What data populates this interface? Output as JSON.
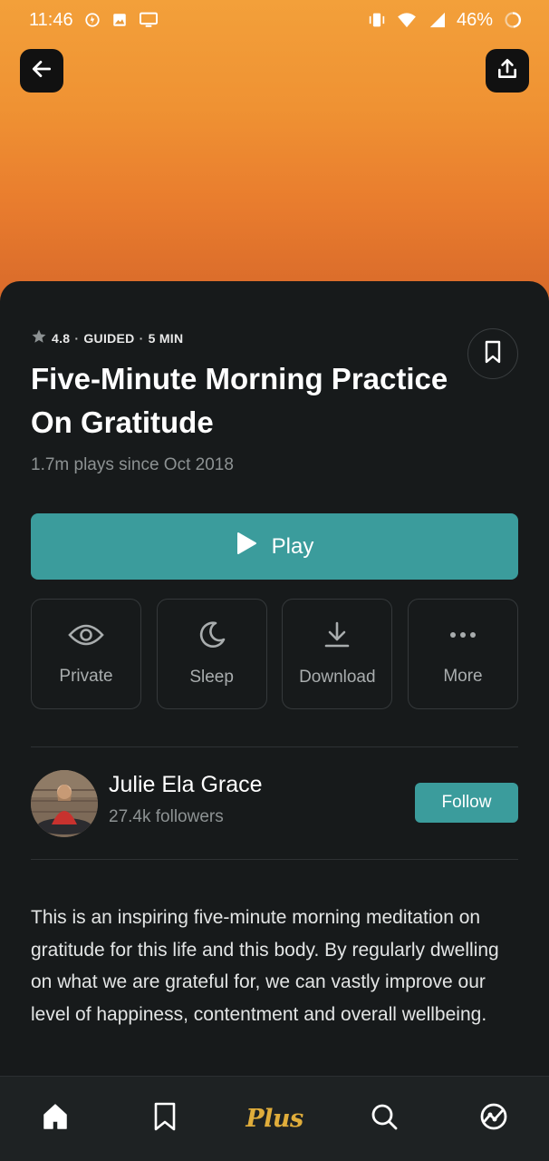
{
  "status_bar": {
    "time": "11:46",
    "battery": "46%",
    "icons_left": [
      "data-saver-icon",
      "image-icon",
      "cast-icon"
    ],
    "icons_right": [
      "vibrate-icon",
      "wifi-icon",
      "signal-icon",
      "battery-icon"
    ]
  },
  "hero": {
    "back_icon": "arrow-left-icon",
    "share_icon": "share-icon"
  },
  "meditation": {
    "rating": "4.8",
    "type": "GUIDED",
    "duration": "5 MIN",
    "separator": "·",
    "title": "Five-Minute Morning Practice On Gratitude",
    "plays": "1.7m plays since Oct 2018",
    "play_label": "Play"
  },
  "actions": [
    {
      "label": "Private",
      "icon": "eye-icon"
    },
    {
      "label": "Sleep",
      "icon": "moon-icon"
    },
    {
      "label": "Download",
      "icon": "download-icon"
    },
    {
      "label": "More",
      "icon": "more-dots-icon"
    }
  ],
  "teacher": {
    "name": "Julie Ela Grace",
    "followers": "27.4k followers",
    "follow_label": "Follow"
  },
  "description": "This is an inspiring five-minute morning meditation on gratitude for this life and this body. By regularly dwelling on what we are grateful for, we can vastly improve our level of happiness, contentment and overall wellbeing.",
  "tabbar": {
    "items": [
      {
        "icon": "home-icon"
      },
      {
        "icon": "bookmark-icon"
      },
      {
        "label": "Plus"
      },
      {
        "icon": "search-icon"
      },
      {
        "icon": "stats-icon"
      }
    ]
  },
  "colors": {
    "accent": "#3b9c9c",
    "plus": "#e0ad3b",
    "background": "#171a1b"
  }
}
